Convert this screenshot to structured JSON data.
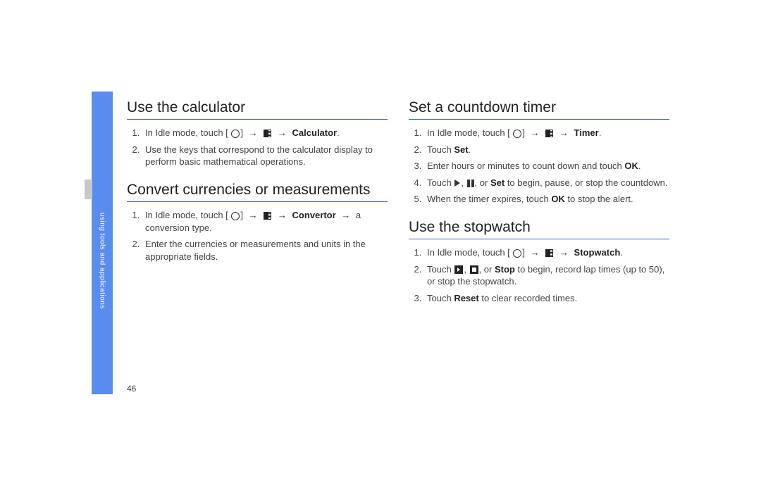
{
  "sidebar": {
    "label": "using tools and applications"
  },
  "page_number": "46",
  "left": {
    "calculator": {
      "heading": "Use the calculator",
      "steps": [
        {
          "prefix": "In Idle mode, touch [",
          "bold": "Calculator"
        },
        {
          "text": "Use the keys that correspond to the calculator display to perform basic mathematical operations."
        }
      ]
    },
    "convertor": {
      "heading": "Convert currencies or measurements",
      "steps": [
        {
          "prefix": "In Idle mode, touch [",
          "bold": "Convertor",
          "suffix": "a conversion type."
        },
        {
          "text": "Enter the currencies or measurements and units in the appropriate fields."
        }
      ]
    }
  },
  "right": {
    "timer": {
      "heading": "Set a countdown timer",
      "steps": [
        {
          "prefix": "In Idle mode, touch [",
          "bold": "Timer"
        },
        {
          "prefix": "Touch ",
          "bold": "Set"
        },
        {
          "prefix": "Enter hours or minutes to count down and touch ",
          "bold": "OK"
        },
        {
          "prefix": "Touch ",
          "mid": "or ",
          "bold": "Set",
          "suffix": " to begin, pause, or stop the countdown."
        },
        {
          "prefix": "When the timer expires, touch ",
          "bold": "OK",
          "suffix": " to stop the alert."
        }
      ]
    },
    "stopwatch": {
      "heading": "Use the stopwatch",
      "steps": [
        {
          "prefix": "In Idle mode, touch [",
          "bold": "Stopwatch"
        },
        {
          "prefix": "Touch ",
          "mid": "or ",
          "bold": "Stop",
          "suffix": " to begin, record lap times (up to 50), or stop the stopwatch."
        },
        {
          "prefix": "Touch ",
          "bold": "Reset",
          "suffix": " to clear recorded times."
        }
      ]
    }
  }
}
